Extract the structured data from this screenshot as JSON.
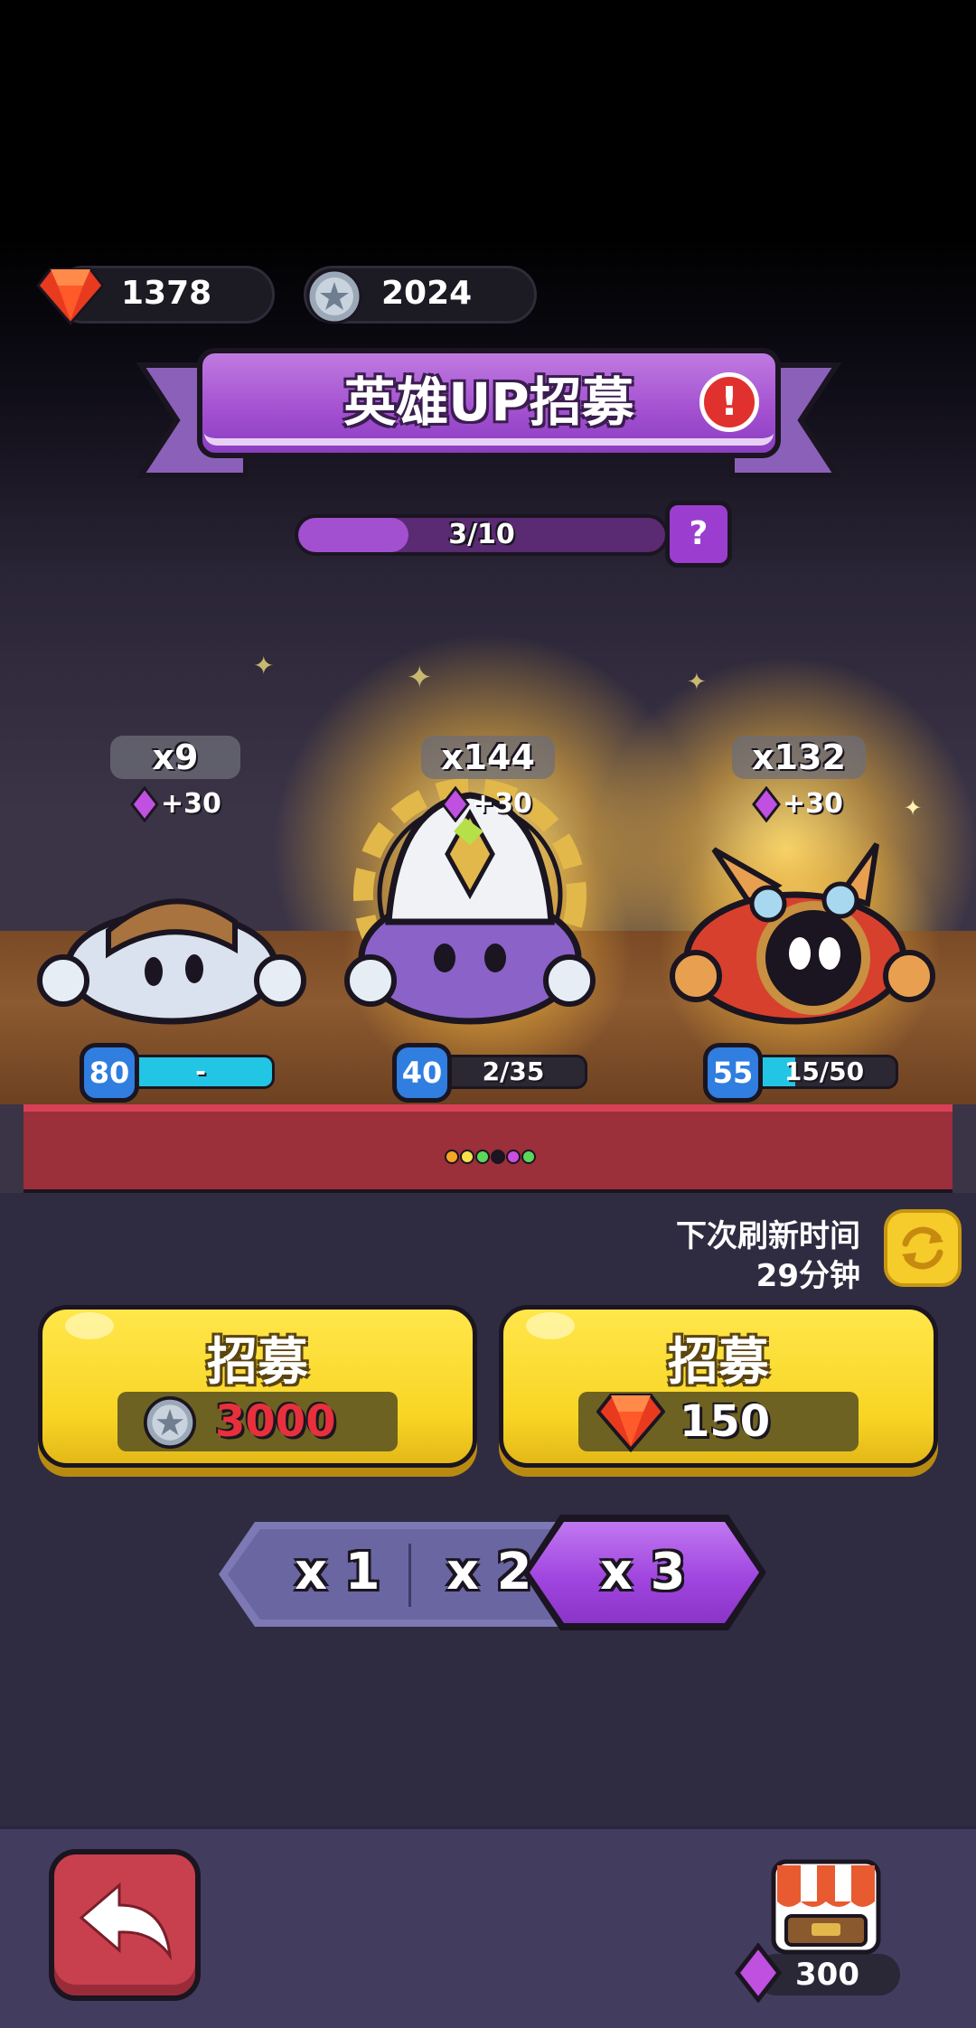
{
  "currency": {
    "gems": "1378",
    "coins": "2024"
  },
  "banner": {
    "title": "英雄UP招募",
    "alert_glyph": "!"
  },
  "progress": {
    "text": "3/10",
    "value": 3,
    "max": 10,
    "help_glyph": "?"
  },
  "heroes": [
    {
      "count": "x9",
      "bonus": "+30",
      "level": "80",
      "shards": "-",
      "shard_fill": 1.0
    },
    {
      "count": "x144",
      "bonus": "+30",
      "level": "40",
      "shards": "2/35",
      "shard_fill": 0.06
    },
    {
      "count": "x132",
      "bonus": "+30",
      "level": "55",
      "shards": "15/50",
      "shard_fill": 0.3
    }
  ],
  "page_dots": [
    "#f5a623",
    "#f5e14a",
    "#5cd65c",
    "#1a1520",
    "#c850e0",
    "#5cd65c"
  ],
  "refresh": {
    "label": "下次刷新时间",
    "time": "29分钟"
  },
  "recruit": {
    "coin_button": {
      "label": "招募",
      "cost": "3000",
      "cost_color": "#e8303c"
    },
    "gem_button": {
      "label": "招募",
      "cost": "150",
      "cost_color": "#ffffff"
    }
  },
  "multipliers": {
    "options": [
      "x 1",
      "x 2",
      "x 3"
    ],
    "selected": "x 3"
  },
  "shop": {
    "price": "300"
  },
  "colors": {
    "gem_red": "#e83a1e",
    "purple": "#a24fd0",
    "yellow": "#f8d524",
    "shard_cyan": "#22c6e4"
  }
}
